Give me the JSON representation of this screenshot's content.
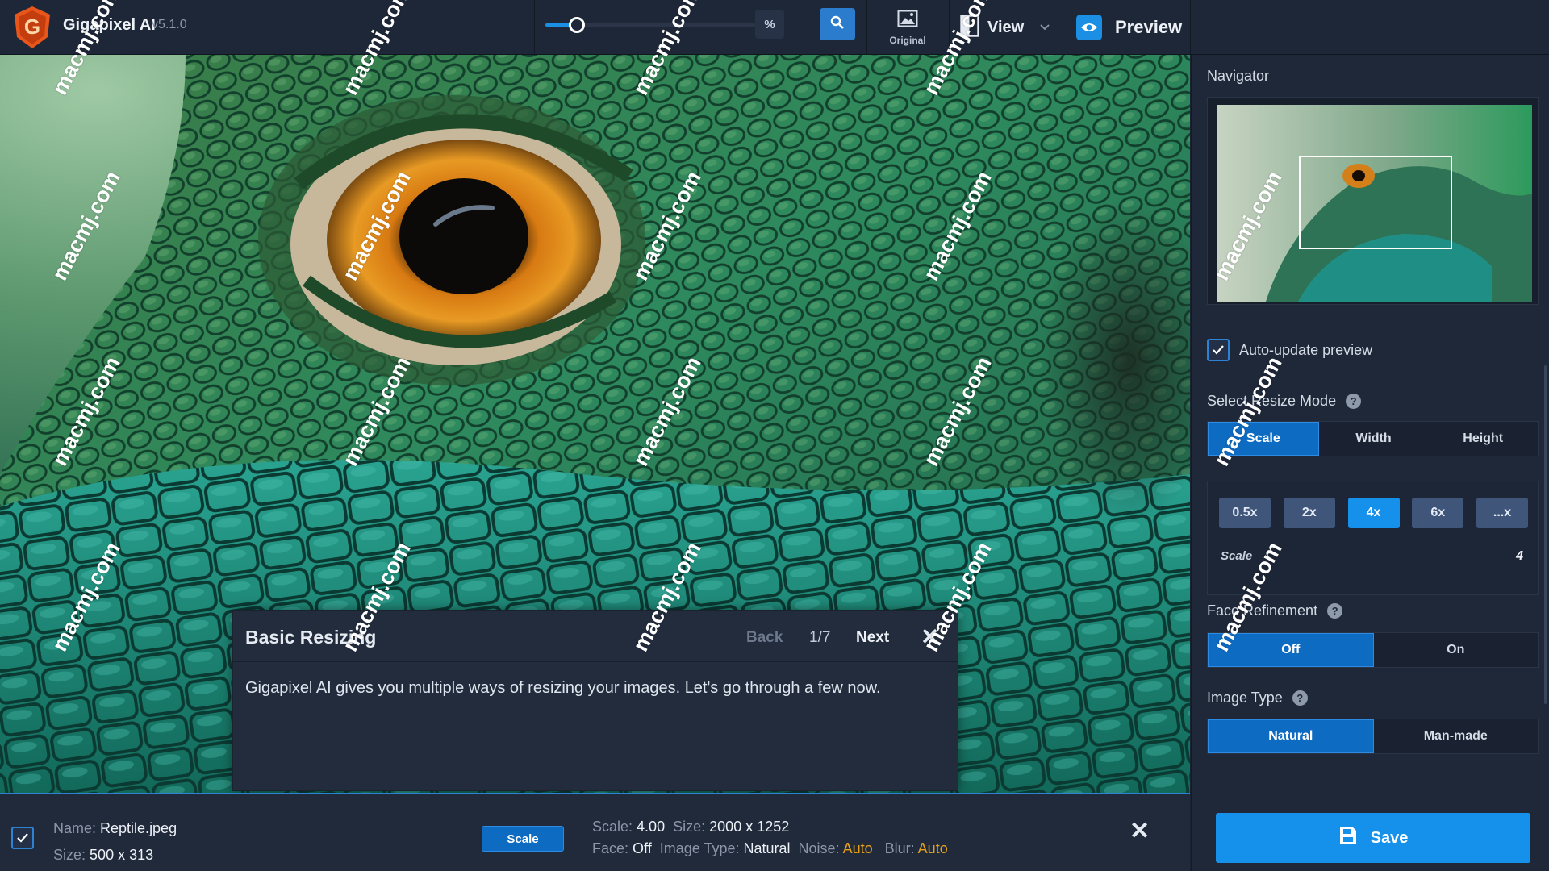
{
  "app": {
    "name": "Gigapixel AI",
    "version": "v5.1.0",
    "logo_letter": "G"
  },
  "toolbar": {
    "zoom_level": 0.15,
    "fit_label": "%",
    "original_label": "Original",
    "view_label": "View",
    "preview_label": "Preview",
    "icons": [
      "gigapixel-logo",
      "zoom-icon",
      "image-icon",
      "split-view-icon",
      "chevron-down-icon",
      "eye-icon"
    ]
  },
  "tutorial": {
    "title": "Basic Resizing",
    "back_label": "Back",
    "step": "1/7",
    "next_label": "Next",
    "close_label": "✕",
    "body": "Gigapixel AI gives you multiple ways of resizing your images. Let's go through a few now."
  },
  "file": {
    "name_label": "Name:",
    "name": "Reptile.jpeg",
    "size_label": "Size:",
    "size": "500 x 313",
    "mode_badge": "Scale",
    "scale_label": "Scale:",
    "scale": "4.00",
    "out_size_label": "Size:",
    "out_size": "2000 x 1252",
    "face_label": "Face:",
    "face": "Off",
    "image_type_label": "Image Type:",
    "image_type": "Natural",
    "noise_label": "Noise:",
    "noise": "Auto",
    "blur_label": "Blur:",
    "blur": "Auto",
    "remove_label": "✕"
  },
  "panel": {
    "navigator_title": "Navigator",
    "auto_update_label": "Auto-update preview",
    "auto_update_checked": true,
    "resize_mode_title": "Select Resize Mode",
    "resize_modes": [
      "Scale",
      "Width",
      "Height"
    ],
    "resize_mode_active": "Scale",
    "scale_presets": [
      "0.5x",
      "2x",
      "4x",
      "6x",
      "...x"
    ],
    "scale_preset_active": "4x",
    "scale_field_label": "Scale",
    "scale_field_value": "4",
    "face_refinement_title": "Face Refinement",
    "face_refinement_options": [
      "Off",
      "On"
    ],
    "face_refinement_active": "Off",
    "image_type_title": "Image Type",
    "image_type_options": [
      "Natural",
      "Man-made"
    ],
    "image_type_active": "Natural",
    "save_label": "Save"
  },
  "watermark": "macmj.com",
  "colors": {
    "accent": "#1591ec",
    "warning": "#e8a21a",
    "background": "#1f2839"
  }
}
